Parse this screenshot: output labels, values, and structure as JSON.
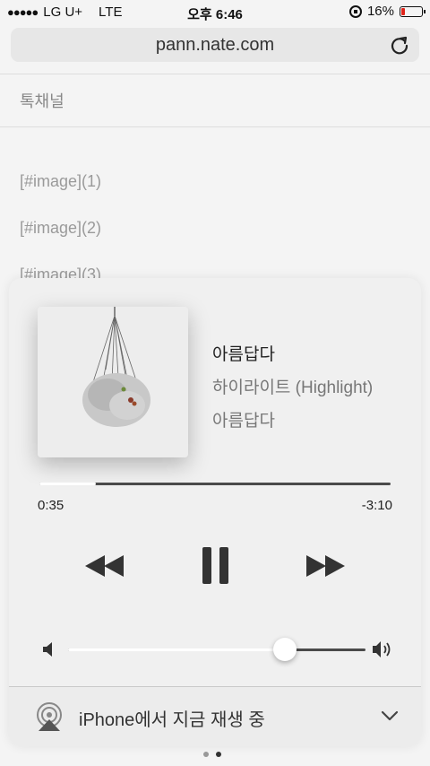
{
  "statusbar": {
    "carrier": "LG U+",
    "network": "LTE",
    "time": "오후 6:46",
    "battery": "16%"
  },
  "browser": {
    "url": "pann.nate.com"
  },
  "background": {
    "channel": "톡채널",
    "lines": [
      "[#image](1)",
      "[#image](2)",
      "[#image](3)"
    ]
  },
  "now_playing": {
    "title": "아름답다",
    "artist": "하이라이트 (Highlight)",
    "album": "아름답다",
    "elapsed": "0:35",
    "remaining": "-3:10",
    "progress": 0.16,
    "volume": 0.73,
    "state": "playing"
  },
  "airplay": {
    "label": "iPhone에서 지금 재생 중"
  },
  "pager": {
    "pages": 2,
    "current": 1
  },
  "colors": {
    "battery_low": "#e0251b"
  }
}
